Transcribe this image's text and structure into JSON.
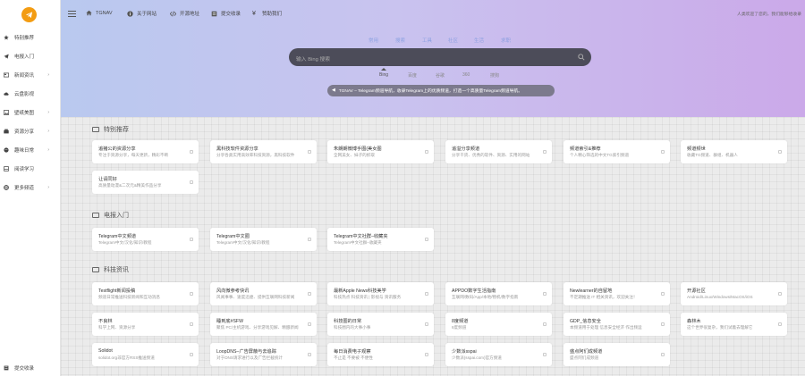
{
  "sidebar": {
    "items": [
      {
        "label": "特别推荐",
        "icon": "star-icon"
      },
      {
        "label": "电报入门",
        "icon": "telegram-icon"
      },
      {
        "label": "新闻资讯",
        "icon": "news-icon",
        "has_children": true
      },
      {
        "label": "云盘影视",
        "icon": "cloud-icon"
      },
      {
        "label": "壁纸美图",
        "icon": "image-icon",
        "has_children": true
      },
      {
        "label": "资源分享",
        "icon": "share-icon",
        "has_children": true
      },
      {
        "label": "趣味日常",
        "icon": "smile-icon",
        "has_children": true
      },
      {
        "label": "阅读学习",
        "icon": "book-icon"
      },
      {
        "label": "更多频道",
        "icon": "globe-icon",
        "has_children": true
      }
    ],
    "bottom_label": "提交收录"
  },
  "topbar": {
    "items": [
      {
        "label": "TGNAV",
        "icon": "home-icon"
      },
      {
        "label": "关于网站",
        "icon": "info-icon"
      },
      {
        "label": "开源地址",
        "icon": "code-icon"
      },
      {
        "label": "提交收录",
        "icon": "submit-icon"
      },
      {
        "label": "赞助我们",
        "icon": "yen-icon"
      }
    ],
    "right_text": "人类欢迎了您的，我们能够给收录"
  },
  "search": {
    "segments": [
      "常用",
      "搜索",
      "工具",
      "社区",
      "生活",
      "求职"
    ],
    "placeholder": "输入 Bing 搜索",
    "engines": [
      "Bing",
      "百度",
      "谷歌",
      "360",
      "搜狗"
    ],
    "active_engine": "Bing"
  },
  "notice": "TGNAV – Telegram频道导航，收录Telegram上的优质频道，打造一个高质量Telegram频道导航。",
  "sections": [
    {
      "title": "特别推荐",
      "cards": [
        {
          "title": "追猪公的资源分享",
          "desc": "专注于资源分享，每天更新，精彩不断"
        },
        {
          "title": "黑科技软件资源分享",
          "desc": "分享各类实用高效率科技资源，黑科技软件"
        },
        {
          "title": "朱朗朗微博手图(美女图",
          "desc": "全网美女、妹子的抓取"
        },
        {
          "title": "追溢分享频道",
          "desc": "分享干货、优秀的软件、资源、实用的网站"
        },
        {
          "title": "频道索引&推荐",
          "desc": "个人精心筛选的中文TG索引频道"
        },
        {
          "title": "频道频世",
          "desc": "收藏TG频道、群组、机器人"
        },
        {
          "title": "让请同好",
          "desc": "高质量动漫&二次元&精美作品分享"
        }
      ]
    },
    {
      "title": "电报入门",
      "cards": [
        {
          "title": "Telegram中文频道",
          "desc": "Telegram中文/汉化/知识/教程"
        },
        {
          "title": "Telegram中文圈",
          "desc": "Telegram中文/汉化/知识/教程"
        },
        {
          "title": "Telegram中文社群–收藏夹",
          "desc": "Telegram中文社群–收藏夹"
        }
      ]
    },
    {
      "title": "科技资讯",
      "cards": [
        {
          "title": "Testflight新闻投稿",
          "desc": "频道日常推送科技新闻和互动消息"
        },
        {
          "title": "风向微参考快讯",
          "desc": "风闻事事、速度迅捷、提供互联网科技新闻"
        },
        {
          "title": "最新Apple News科技美学",
          "desc": "科技热点 科技资讯 | 影视与 资讯服务"
        },
        {
          "title": "APPDO数字生活指南",
          "desc": "互联网/数码/App/本地/物机/数字指南"
        },
        {
          "title": "Newlearner的自留地",
          "desc": "不定期推送 IT 相关资讯，欢迎关注！"
        },
        {
          "title": "开源社区",
          "desc": "Android/Linux/Windows/MacOS/iOS"
        },
        {
          "title": "不良林",
          "desc": "科学上网、资源分享"
        },
        {
          "title": "睡到底#SFW",
          "desc": "聚焦 PC/主机游戏、分享游戏见解、精酿新闻"
        },
        {
          "title": "科技圈的日常",
          "desc": "科技圈内的大事小事"
        },
        {
          "title": "8度频道",
          "desc": "8度频道"
        },
        {
          "title": "GDP_信息安全",
          "desc": "本频道用于处理 信息安全经济 作出频运"
        },
        {
          "title": "森林木",
          "desc": "这个世界很复杂，我们试着去理解它"
        },
        {
          "title": "Solidot",
          "desc": "solidot.org非官方RSS推送频道"
        },
        {
          "title": "LoopDNS–广告屏蔽与去追踪",
          "desc": "对于DNS请求进行以及广告拦截统计"
        },
        {
          "title": "每日消费电子观察",
          "desc": "不止是 不要被 不便性"
        },
        {
          "title": "少数派sspai",
          "desc": "少数派(sspai.com)官方频道"
        },
        {
          "title": "盛点阿们成频道",
          "desc": "盛点阿们成频道"
        }
      ]
    }
  ],
  "colors": {
    "logo": "#f39c12",
    "hero_start": "#b9c9ef",
    "hero_end": "#cba9e9",
    "search_bg": "#4c4c59",
    "notice_bg": "#7c7a8d"
  }
}
